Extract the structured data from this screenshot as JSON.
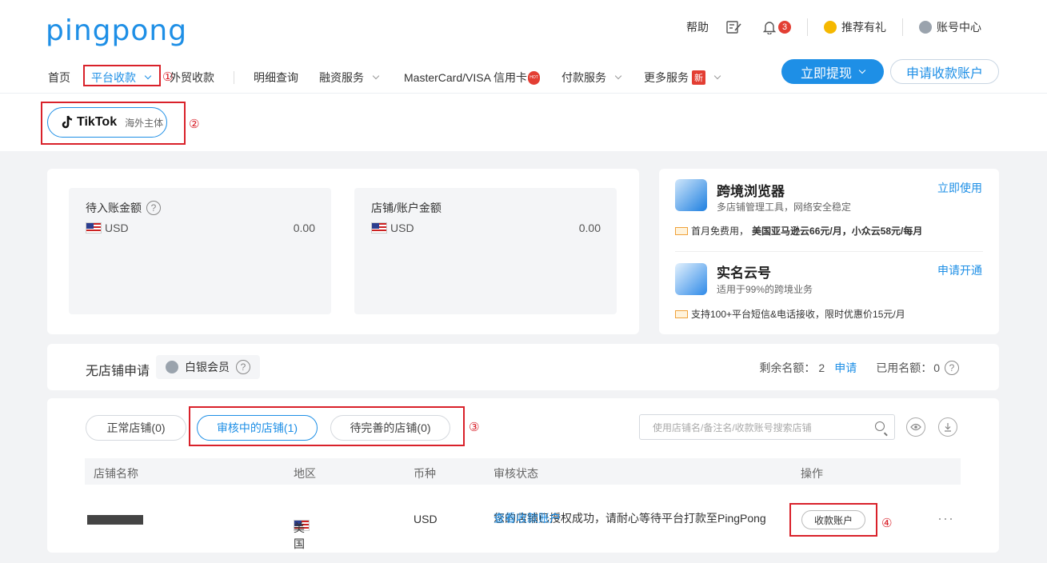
{
  "brand": {
    "logo_text": "pingpong"
  },
  "topbar": {
    "help": "帮助",
    "notification_count": "3",
    "referral": "推荐有礼",
    "account_center": "账号中心"
  },
  "nav": {
    "home": "首页",
    "platform_collection": "平台收款",
    "foreign_trade": "外贸收款",
    "details": "明细查询",
    "financing": "融资服务",
    "credit_card": "MasterCard/VISA 信用卡",
    "hot_badge": "HOT",
    "payment": "付款服务",
    "more": "更多服务",
    "new_badge": "新"
  },
  "actions": {
    "withdraw": "立即提现",
    "apply_account": "申请收款账户"
  },
  "annotations": {
    "n1": "①",
    "n2": "②",
    "n3": "③",
    "n4": "④"
  },
  "platform": {
    "name": "TikTok",
    "sub": "海外主体"
  },
  "balances": {
    "pending": {
      "title": "待入账金额",
      "currency": "USD",
      "amount": "0.00"
    },
    "store": {
      "title": "店铺/账户金额",
      "currency": "USD",
      "amount": "0.00"
    }
  },
  "promos": {
    "browser": {
      "title": "跨境浏览器",
      "sub": "多店铺管理工具，网络安全稳定",
      "link": "立即使用",
      "note_pre": "首月免费用，",
      "note_bold": "美国亚马逊云66元/月，小众云58元/每月"
    },
    "cloudnum": {
      "title": "实名云号",
      "sub": "适用于99%的跨境业务",
      "link": "申请开通",
      "note": "支持100+平台短信&电话接收，限时优惠价15元/月"
    }
  },
  "nostore": {
    "title": "无店铺申请",
    "member": "白银会员",
    "remaining_label": "剩余名额：",
    "remaining": "2",
    "apply": "申请",
    "used_label": "已用名额：",
    "used": "0"
  },
  "stores": {
    "tabs": [
      "正常店铺(0)",
      "审核中的店铺(1)",
      "待完善的店铺(0)"
    ],
    "search_placeholder": "使用店铺名/备注名/收款账号搜索店铺",
    "columns": {
      "name": "店铺名称",
      "region": "地区",
      "currency": "币种",
      "status": "审核状态",
      "op": "操作"
    },
    "row": {
      "region": "美国",
      "currency": "USD",
      "status_text": "您的店铺已授权成功，请耐心等待平台打款至PingPong ",
      "status_link": "查看收款账户",
      "action": "收款账户"
    }
  },
  "colors": {
    "accent": "#1e8fe6",
    "annotation": "#d9212a",
    "badge": "#e33e33"
  }
}
